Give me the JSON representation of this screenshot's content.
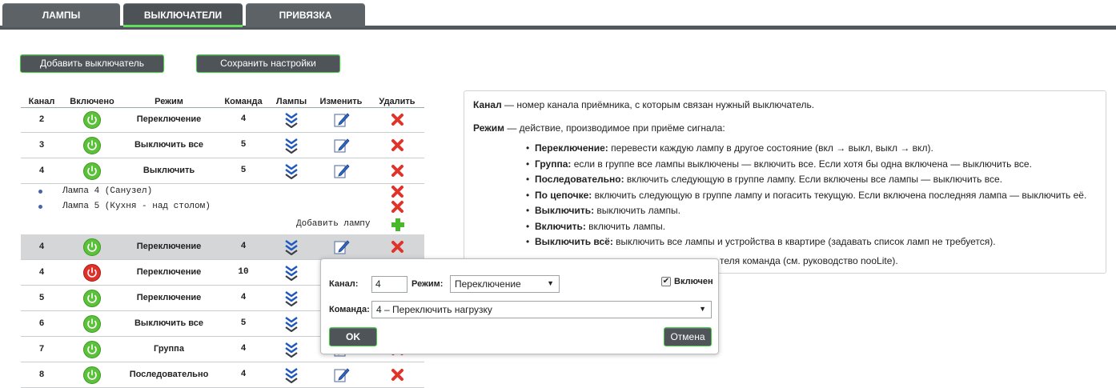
{
  "tabs": [
    {
      "label": "ЛАМПЫ",
      "active": false
    },
    {
      "label": "ВЫКЛЮЧАТЕЛИ",
      "active": true
    },
    {
      "label": "ПРИВЯЗКА",
      "active": false
    }
  ],
  "toolbar": {
    "add_switch_label": "Добавить выключатель",
    "save_settings_label": "Сохранить настройки"
  },
  "table": {
    "headers": {
      "channel": "Канал",
      "enabled": "Включено",
      "mode": "Режим",
      "command": "Команда",
      "lamps": "Лампы",
      "edit": "Изменить",
      "delete": "Удалить"
    },
    "rows": [
      {
        "channel": "2",
        "enabled": true,
        "mode": "Переключение",
        "command": "4"
      },
      {
        "channel": "3",
        "enabled": true,
        "mode": "Выключить все",
        "command": "5"
      },
      {
        "channel": "4",
        "enabled": true,
        "mode": "Выключить",
        "command": "5"
      },
      {
        "channel": "4",
        "enabled": true,
        "mode": "Переключение",
        "command": "4"
      },
      {
        "channel": "4",
        "enabled": false,
        "mode": "Переключение",
        "command": "10"
      },
      {
        "channel": "5",
        "enabled": true,
        "mode": "Переключение",
        "command": "4"
      },
      {
        "channel": "6",
        "enabled": true,
        "mode": "Выключить все",
        "command": "5"
      },
      {
        "channel": "7",
        "enabled": true,
        "mode": "Группа",
        "command": "4"
      },
      {
        "channel": "8",
        "enabled": true,
        "mode": "Последовательно",
        "command": "4"
      }
    ],
    "expanded_lamps": [
      "Лампа 4 (Санузел)",
      "Лампа 5 (Кухня - над столом)"
    ],
    "add_lamp_label": "Добавить лампу"
  },
  "help": {
    "channel_term": "Канал",
    "channel_desc": " — номер канала приёмника, с которым связан нужный выключатель.",
    "mode_term": "Режим",
    "mode_desc": " — действие, производимое при приёме сигнала:",
    "modes": [
      {
        "term": "Переключение:",
        "desc": " перевести каждую лампу в другое состояние (вкл → выкл, выкл → вкл)."
      },
      {
        "term": "Группа:",
        "desc": " если в группе все лампы выключены — включить все. Если хотя бы одна включена — выключить все."
      },
      {
        "term": "Последовательно:",
        "desc": " включить следующую в группе лампу. Если включены все лампы — выключить все."
      },
      {
        "term": "По цепочке:",
        "desc": " включить следующую в группе лампу и погасить текущую. Если включена последняя лампа — выключить её."
      },
      {
        "term": "Выключить:",
        "desc": " выключить лампы."
      },
      {
        "term": "Включить:",
        "desc": " включить лампы."
      },
      {
        "term": "Выключить всё:",
        "desc": " выключить все лампы и устройства в квартире (задавать список ламп не требуется)."
      }
    ],
    "footer_tail": "теля команда (см. руководство nooLite)."
  },
  "dialog": {
    "channel_label": "Канал:",
    "channel_value": "4",
    "mode_label": "Режим:",
    "mode_value": "Переключение",
    "enabled_label": "Включен",
    "enabled_checked": true,
    "command_label": "Команда:",
    "command_value": "4 – Переключить нагрузку",
    "ok_label": "OK",
    "cancel_label": "Отмена"
  },
  "colors": {
    "accent_green": "#3ad23a",
    "power_on": "#5cc13a",
    "power_off": "#e0302a",
    "delete_red": "#e0332a",
    "add_green": "#49b92c",
    "lamps_blue": "#1f57c2"
  }
}
